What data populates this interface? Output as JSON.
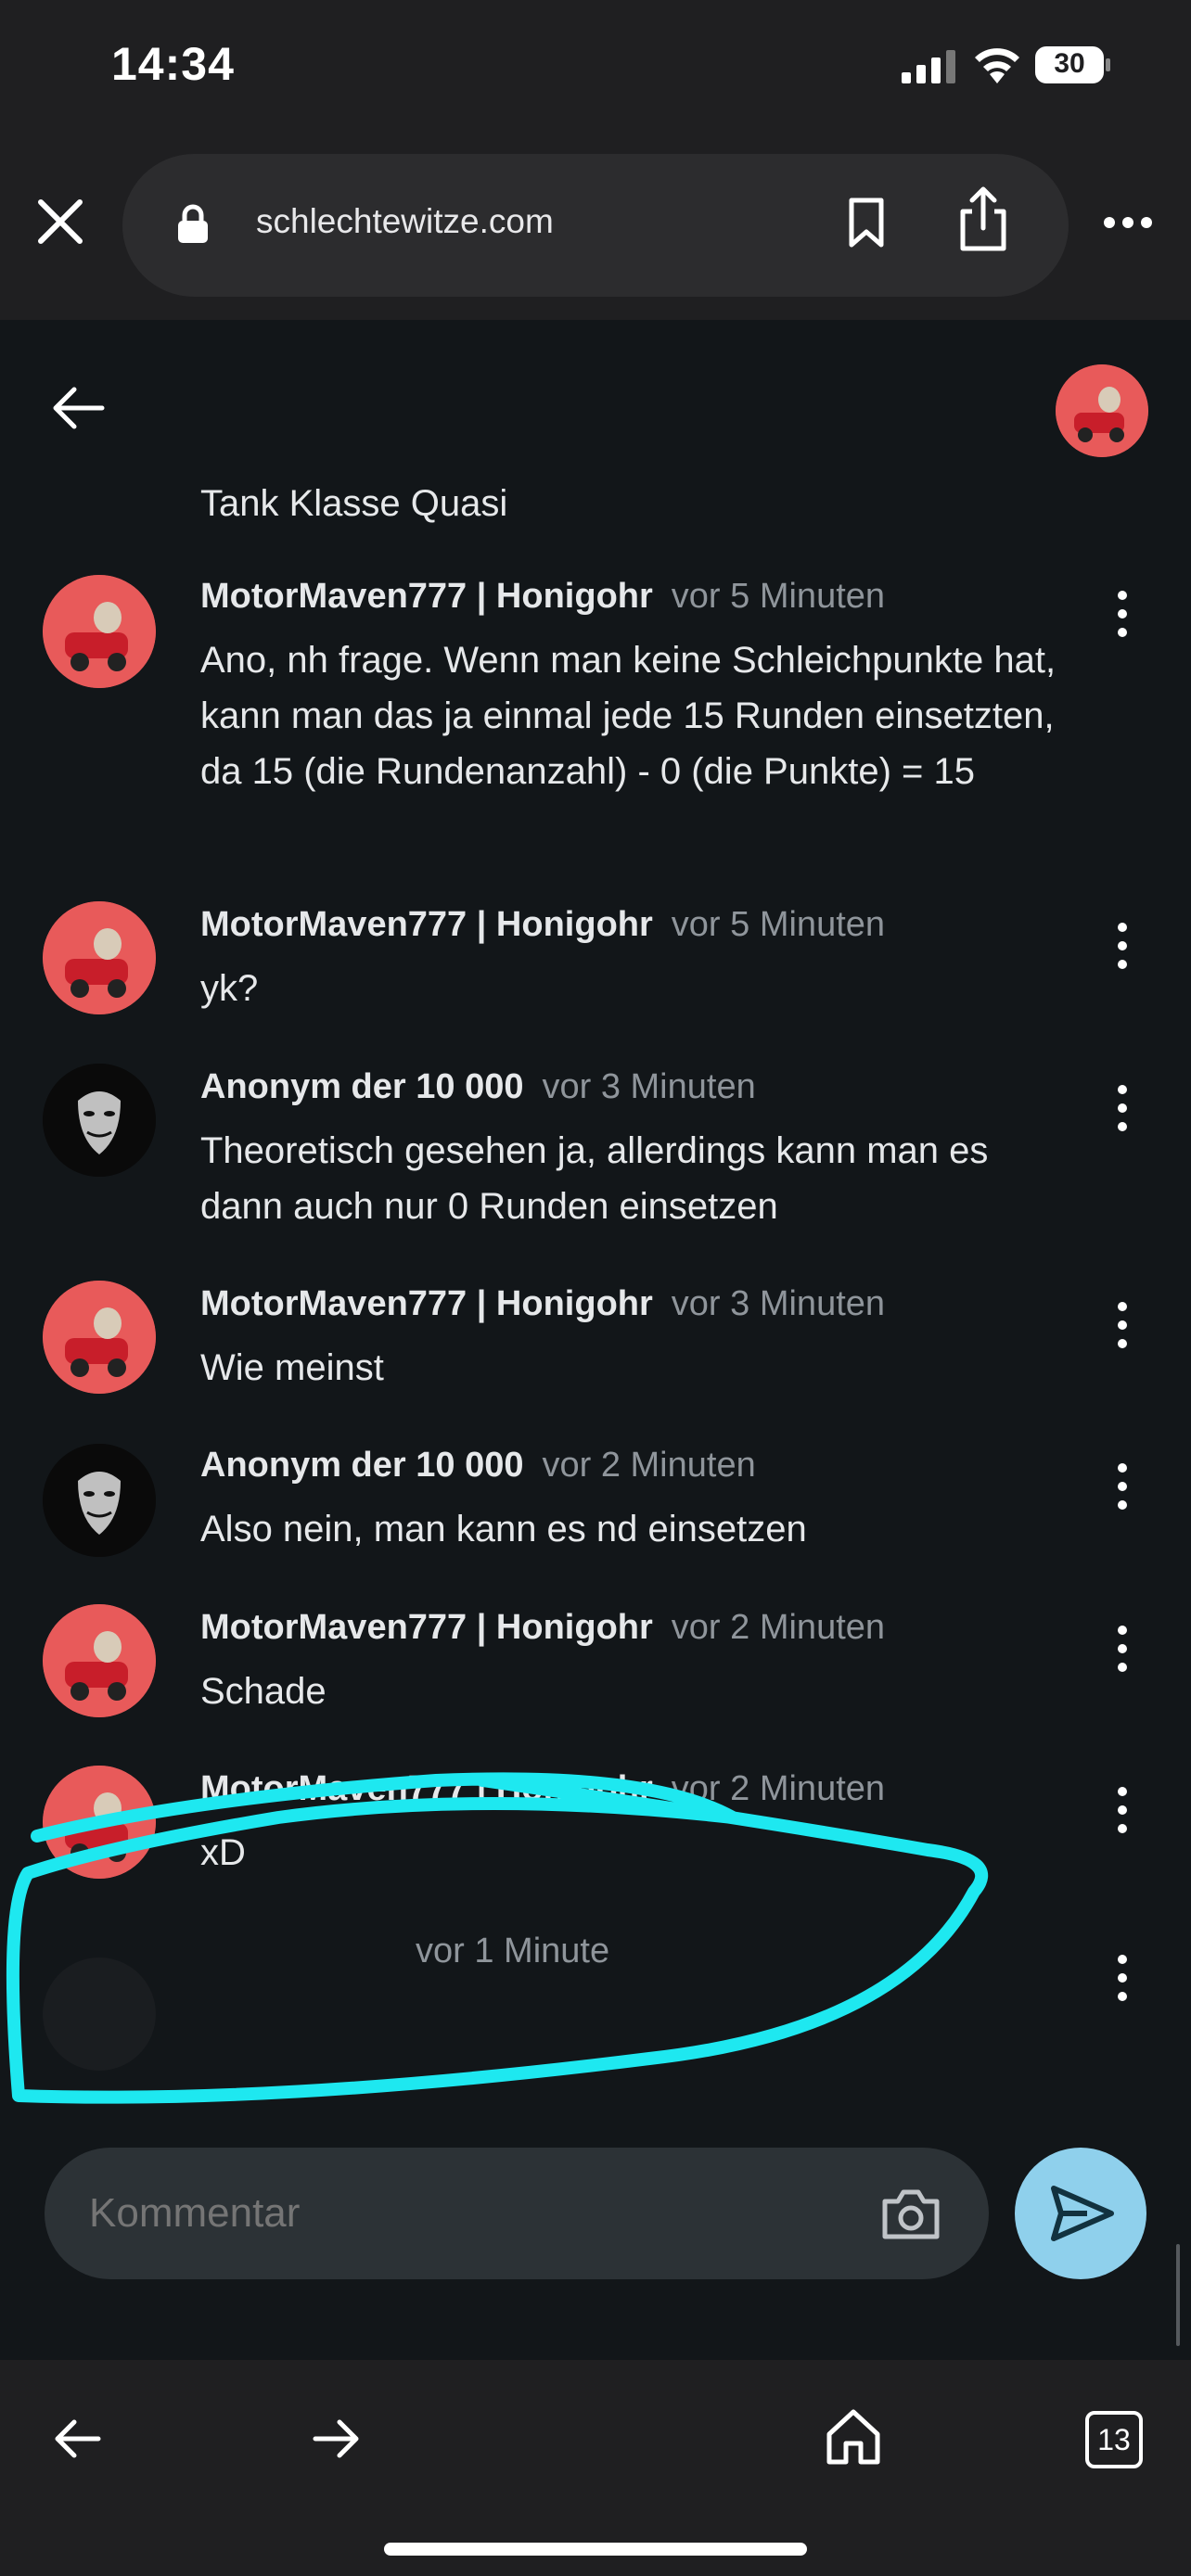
{
  "status_bar": {
    "time": "14:34",
    "battery": "30"
  },
  "browser": {
    "url": "schlechtewitze.com",
    "open_tabs": "13"
  },
  "thread": {
    "cut_off_text": "Tank Klasse Quasi",
    "comments": [
      {
        "author": "MotorMaven777 | Honigohr",
        "time": "vor 5 Minuten",
        "text": "Ano, nh frage. Wenn man keine Schleichpunkte hat, kann man das ja einmal jede 15 Runden einsetzten, da 15 (die Rundenanzahl) - 0 (die Punkte) = 15"
      },
      {
        "author": "MotorMaven777 | Honigohr",
        "time": "vor 5 Minuten",
        "text": "yk?"
      },
      {
        "author": "Anonym der 10 000",
        "time": "vor 3 Minuten",
        "text": "Theoretisch gesehen ja, allerdings kann man es dann auch nur 0 Runden einsetzen"
      },
      {
        "author": "MotorMaven777 | Honigohr",
        "time": "vor 3 Minuten",
        "text": "Wie meinst"
      },
      {
        "author": "Anonym der 10 000",
        "time": "vor 2 Minuten",
        "text": "Also nein, man kann es nd einsetzen"
      },
      {
        "author": "MotorMaven777 | Honigohr",
        "time": "vor 2 Minuten",
        "text": "Schade"
      },
      {
        "author": "MotorMaven777 | Honigohr",
        "time": "vor 2 Minuten",
        "text": "xD"
      },
      {
        "author": "",
        "time": "vor 1 Minute",
        "text": ""
      }
    ]
  },
  "composer": {
    "placeholder": "Kommentar"
  },
  "colors": {
    "background": "#121619",
    "bar": "#1f1f21",
    "send": "#8fd0ec",
    "highlight": "#1ee8f0",
    "avatar_red": "#e85a5a"
  },
  "icons": [
    "close-icon",
    "lock-icon",
    "bookmark-icon",
    "share-icon",
    "more-icon",
    "back-arrow-icon",
    "kebab-icon",
    "camera-icon",
    "send-icon",
    "home-icon",
    "tabs-icon"
  ]
}
